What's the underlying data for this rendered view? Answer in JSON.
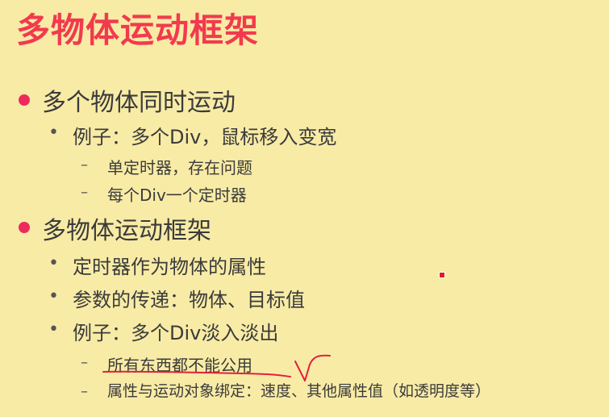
{
  "title": "多物体运动框架",
  "sections": [
    {
      "heading": "多个物体同时运动",
      "items": [
        {
          "text": "例子：多个Div，鼠标移入变宽",
          "subitems": [
            "单定时器，存在问题",
            "每个Div一个定时器"
          ]
        }
      ]
    },
    {
      "heading": "多物体运动框架",
      "items": [
        {
          "text": "定时器作为物体的属性",
          "subitems": []
        },
        {
          "text": "参数的传递：物体、目标值",
          "subitems": []
        },
        {
          "text": "例子：多个Div淡入淡出",
          "subitems": [
            "所有东西都不能公用",
            "属性与运动对象绑定：速度、其他属性值（如透明度等）"
          ]
        }
      ]
    }
  ],
  "bullet_markers": {
    "level2": "•",
    "level3": "–"
  },
  "colors": {
    "background": "#f8eba6",
    "title": "#f23a4e",
    "bullet": "#ee2a5c",
    "annotation": "#e3203a"
  }
}
